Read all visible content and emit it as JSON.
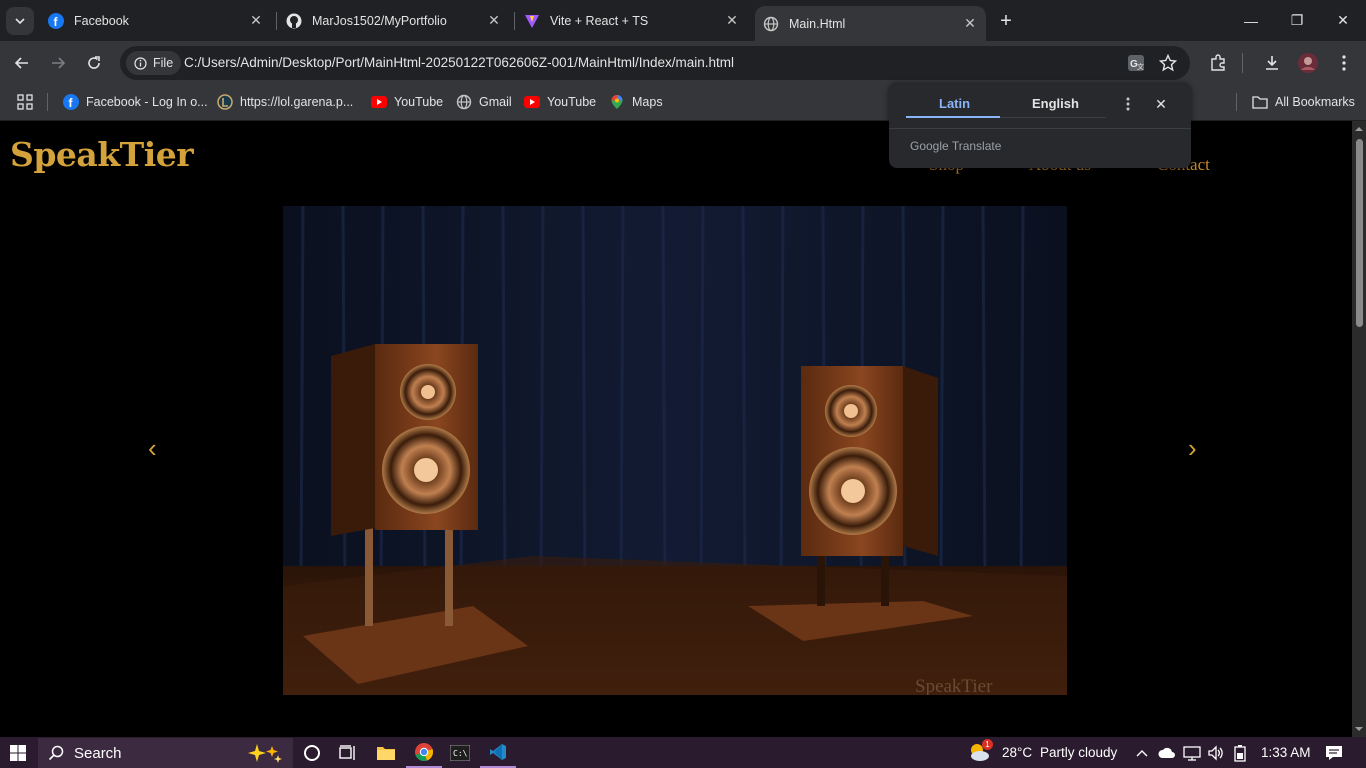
{
  "browser": {
    "tabs": [
      {
        "title": "Facebook",
        "icon": "facebook-icon"
      },
      {
        "title": "MarJos1502/MyPortfolio",
        "icon": "github-icon"
      },
      {
        "title": "Vite + React + TS",
        "icon": "vite-icon"
      },
      {
        "title": "Main.Html",
        "icon": "globe-icon",
        "active": true
      }
    ],
    "site_chip": "File",
    "url": "C:/Users/Admin/Desktop/Port/MainHtml-20250122T062606Z-001/MainHtml/Index/main.html",
    "bookmarks": [
      {
        "label": "Facebook - Log In o...",
        "icon": "facebook-icon"
      },
      {
        "label": "https://lol.garena.p...",
        "icon": "lol-icon"
      },
      {
        "label": "YouTube",
        "icon": "youtube-icon"
      },
      {
        "label": "Gmail",
        "icon": "globe-icon"
      },
      {
        "label": "YouTube",
        "icon": "youtube-icon"
      },
      {
        "label": "Maps",
        "icon": "maps-icon"
      }
    ],
    "all_bookmarks": "All Bookmarks"
  },
  "translate": {
    "source_lang": "Latin",
    "target_lang": "English",
    "footer_brand": "Google",
    "footer_product": "Translate"
  },
  "site": {
    "brand": "SpeakTier",
    "nav": [
      "Shop",
      "About us",
      "Contact"
    ],
    "hero_caption": "SpeakTier",
    "prev_arrow": "‹",
    "next_arrow": "›"
  },
  "taskbar": {
    "search_placeholder": "Search",
    "weather_badge": "1",
    "temperature": "28°C",
    "weather": "Partly cloudy",
    "time": "1:33 AM"
  },
  "colors": {
    "brand_gold": "#d4a23a",
    "nav_gold": "#c7892a",
    "chrome_dark": "#202124",
    "chrome_toolbar": "#35363a",
    "taskbar": "#2a1b2e",
    "accent_blue": "#8ab4f8"
  }
}
